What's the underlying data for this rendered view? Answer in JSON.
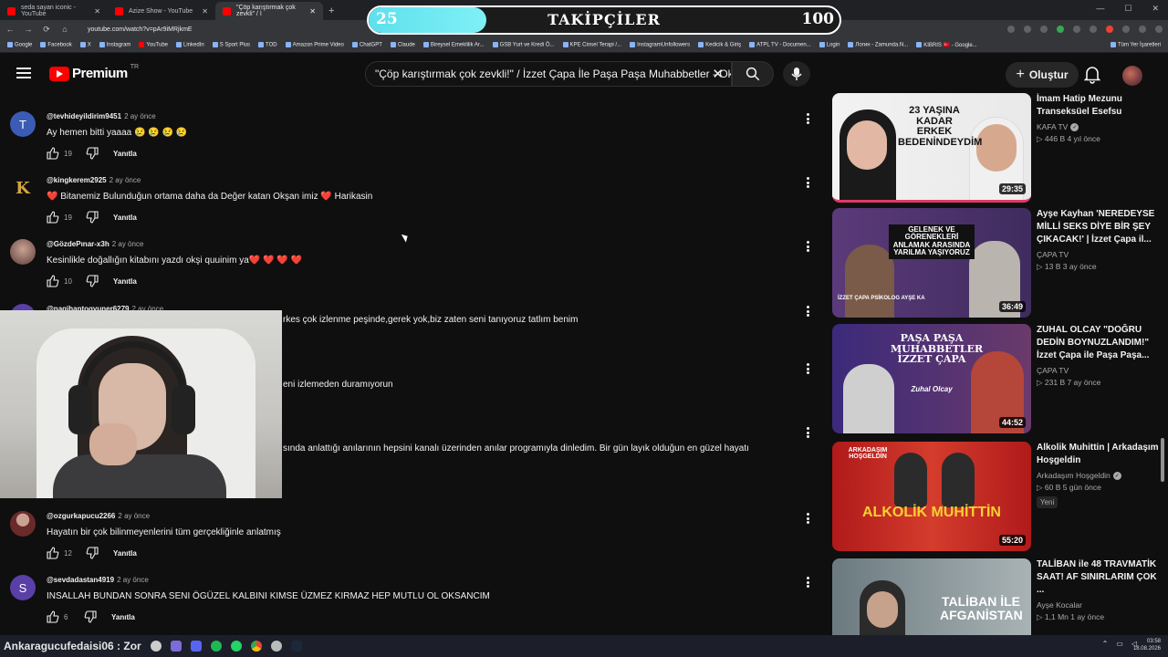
{
  "browser": {
    "tabs": [
      {
        "title": "seda sayan iconic - YouTube"
      },
      {
        "title": "Azize Show - YouTube"
      },
      {
        "title": "\"Çöp karıştırmak çok zevkli\" / İ",
        "active": true
      }
    ],
    "url": "youtube.com/watch?v=pAr9iMRjkmE",
    "bookmarks": [
      "Google",
      "Facebook",
      "X",
      "Instagram",
      "YouTube",
      "LinkedIn",
      "S Sport Plus",
      "TOD",
      "Amazon Prime Video",
      "ChatGPT",
      "Claude",
      "Bireysel Emeklilik Ar...",
      "GSB Yurt ve Kredi Ö...",
      "KPE Cinsel Terapi /...",
      "InstagramUnfollowers",
      "Kedicik & Giriş",
      "ATPL TV - Documen...",
      "Login",
      "Логин - Zamunda.N...",
      "KIBRIS 🇹🇷 - Google...",
      "Tüm Yer İşaretleri"
    ]
  },
  "follow_goal": {
    "current": "25",
    "target": "100",
    "label": "TAKİPÇİLER",
    "progress": 0.25
  },
  "youtube": {
    "brand": "Premium",
    "country": "TR",
    "search_query": "\"Çöp karıştırmak çok zevkli!\" / İzzet Çapa İle Paşa Paşa Muhabbetler - Oksan",
    "create_label": "Oluştur"
  },
  "comments": [
    {
      "handle": "@tevhideyildirim9451",
      "time": "2 ay önce",
      "text": "Ay hemen bitti yaaaa 😢 😢 😢 😢",
      "likes": "19",
      "reply": "Yanıtla",
      "avatar_letter": "T",
      "avatar_color": "#3b5bb5"
    },
    {
      "handle": "@kingkerem2925",
      "time": "2 ay önce",
      "text": "❤️ Bitanemiz Bulunduğun ortama daha da  Değer katan Okşan imiz ❤️  Harikasin",
      "likes": "19",
      "reply": "Yanıtla",
      "avatar_letter": "K",
      "avatar_color": "#b38a2e"
    },
    {
      "handle": "@GözdePınar-x3h",
      "time": "2 ay önce",
      "text": "Kesinlikle doğallığın kitabını yazdı okşi quuinim ya❤️ ❤️ ❤️ ❤️",
      "likes": "10",
      "reply": "Yanıtla",
      "avatar_letter": "",
      "avatar_color": "#8a6b64"
    },
    {
      "handle": "@nagihantogyuner6279",
      "time": "2 ay önce",
      "text": "",
      "likes": "",
      "reply": "",
      "avatar_letter": "n",
      "avatar_color": "#5a3fa6"
    },
    {
      "handle": "@ozgurkapucu2266",
      "time": "2 ay önce",
      "text": "Hayatın bir çok bilinmeyenlerini tüm gerçekliğinle anlatmış",
      "likes": "12",
      "reply": "Yanıtla",
      "avatar_letter": "",
      "avatar_color": "#6b2a2a"
    },
    {
      "handle": "@sevdadastan4919",
      "time": "2 ay önce",
      "text": "INSALLAH BUNDAN SONRA SENI ÖGÜZEL KALBINI KIMSE ÜZMEZ KIRMAZ HEP MUTLU OL OKSANCIM",
      "likes": "6",
      "reply": "Yanıtla",
      "avatar_letter": "S",
      "avatar_color": "#5a3fa6"
    }
  ],
  "partial_texts": {
    "line1": "rkes çok izlenme peşinde,gerek yok,biz zaten seni tanıyoruz tatlım benim",
    "line2": "eni izlemeden duramıyorun",
    "line3": "sında anlattığı anılarının hepsini kanalı üzerinden anılar programıyla dinledim. Bir gün layık olduğun en güzel hayatı"
  },
  "recommendations": [
    {
      "title": "İmam Hatip Mezunu Transeksüel Esefsu Anlatıyor! | Gökhan Çınar...",
      "channel": "KAFA TV",
      "verified": true,
      "stats": "▷ 446 B   4 yıl önce",
      "duration": "29:35",
      "thumb_text": "23 YAŞINA KADAR ERKEK BEDENİNDEYDİM",
      "new": ""
    },
    {
      "title": "Ayşe Kayhan 'NEREDEYSE MİLLİ SEKS DİYE BİR ŞEY ÇIKACAK!' | İzzet Çapa il...",
      "channel": "ÇAPA TV",
      "verified": false,
      "stats": "▷ 13 B   3 ay önce",
      "duration": "36:49",
      "thumb_text": "GELENEK VE GÖRENEKLERİ ANLAMAK ARASINDA YARILMA YAŞIYORUZ",
      "thumb_sub": "İZZET ÇAPA      PSİKOLOG AYŞE KA",
      "new": ""
    },
    {
      "title": "ZUHAL OLCAY \"DOĞRU DEDİN BOYNUZLANDIM!\" İzzet Çapa ile Paşa Paşa...",
      "channel": "ÇAPA TV",
      "verified": false,
      "stats": "▷ 231 B   7 ay önce",
      "duration": "44:52",
      "thumb_text": "PAŞA PAŞA MUHABBETLER İZZET ÇAPA",
      "thumb_sub": "Zuhal Olcay",
      "new": ""
    },
    {
      "title": "Alkolik Muhittin | Arkadaşım Hoşgeldin",
      "channel": "Arkadaşım Hoşgeldin",
      "verified": true,
      "stats": "▷ 60 B   5 gün önce",
      "duration": "55:20",
      "thumb_text": "ALKOLİK MUHİTTİN",
      "thumb_sub": "ARKADAŞIM HOŞGELDİN",
      "new": "Yeni"
    },
    {
      "title": "TALİBAN ile 48 TRAVMATİK SAAT! AF SINIRLARIM ÇOK ...",
      "channel": "Ayşe Kocalar",
      "verified": false,
      "stats": "▷ 1,1 Mn   1 ay önce",
      "duration": "",
      "thumb_text": "TALİBAN İLE AFGANİSTAN",
      "new": ""
    }
  ],
  "taskbar": {
    "text": "Ankaragucufedaisi06 : Zor",
    "time": "03:58",
    "date": "18.08.2026"
  },
  "colors": {
    "youtube_red": "#ff0000",
    "background": "#0f0f0f",
    "follow_fill": "#6ee8f2"
  }
}
